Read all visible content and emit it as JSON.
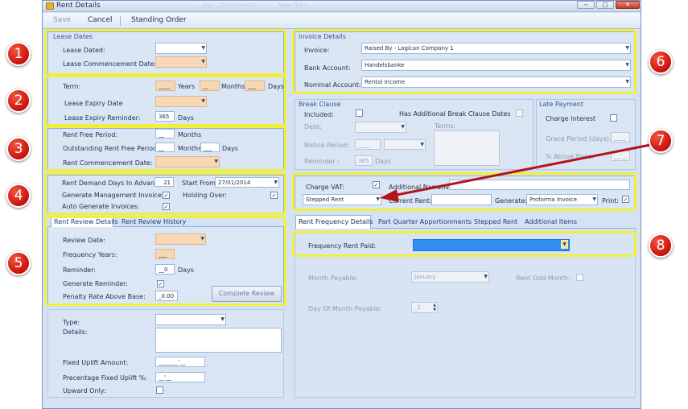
{
  "window": {
    "title": "Rent Details",
    "ghost_text": [
      "...ons \\ Documents",
      "New Item"
    ],
    "controls": [
      "−",
      "□",
      "✕"
    ]
  },
  "toolbar": {
    "save": "Save",
    "cancel": "Cancel",
    "standing_order": "Standing Order"
  },
  "lease_dates": {
    "title": "Lease Dates",
    "lease_dated_label": "Lease Dated:",
    "commencement_label": "Lease Commencement Date:"
  },
  "term": {
    "term_label": "Term:",
    "years_value": "____",
    "years_label": "Years",
    "months_value": "__",
    "months_label": "Months",
    "days_value": "___",
    "days_label": "Days",
    "expiry_label": "Lease Expiry Date",
    "reminder_label": "Lease  Expiry Reminder:",
    "reminder_value": "365",
    "reminder_days": "Days"
  },
  "rent_free": {
    "period_label": "Rent Free Period:",
    "period_value": "__",
    "period_months": "Months",
    "outstanding_label": "Outstanding Rent Free Period:",
    "outstanding_value": "__",
    "outstanding_months": "Months",
    "outstanding_days_value": "___",
    "outstanding_days": "Days",
    "commencement_label": "Rent Commencement Date:"
  },
  "demand": {
    "advance_label": "Rent Demand Days In Advance:",
    "advance_value": "21",
    "start_label": "Start From:",
    "start_value": "27/01/2014",
    "mgmt_invoice_label": "Generate Management Invoice:",
    "mgmt_invoice_checked": "✓",
    "holding_over_label": "Holding Over:",
    "holding_over_checked": "✓",
    "auto_invoices_label": "Auto Generate Invoices:",
    "auto_invoices_checked": "✓"
  },
  "rent_review": {
    "tabs": [
      "Rent Review Details",
      "Rent Review History"
    ],
    "review_date_label": "Review Date:",
    "frequency_label": "Frequency Years:",
    "frequency_value": "___",
    "reminder_label": "Reminder:",
    "reminder_value": "__0",
    "reminder_days": "Days",
    "gen_reminder_label": "Generate Reminder:",
    "gen_reminder_checked": "✓",
    "penalty_label": "Penalty Rate Above Base:",
    "penalty_value": "_0.00",
    "complete_button": "Complete Review"
  },
  "uplift": {
    "type_label": "Type:",
    "details_label": "Details:",
    "fixed_label": "Fixed Uplift Amount:",
    "fixed_value": "_______'__",
    "pct_label": "Precentage Fixed Uplift %:",
    "pct_value": "__'__",
    "upward_label": "Upward Only:"
  },
  "invoice_details": {
    "title": "Invoice Details",
    "invoice_label": "Invoice:",
    "invoice_value": "Raised By - Logican Company 1",
    "bank_label": "Bank Account:",
    "bank_value": "Handelsbanke",
    "nominal_label": "Nominal Account:",
    "nominal_value": "Rental Income"
  },
  "break_clause": {
    "title": "Break Clause",
    "included_label": "Included:",
    "additional_label": "Has Additional Break Clause Dates",
    "date_label": "Date:",
    "terms_label": "Terms:",
    "notice_label": "Notice Period:",
    "notice_value": "____",
    "reminder_label": "Reminder :",
    "reminder_value": "365",
    "reminder_days": "Days"
  },
  "late_payment": {
    "title": "Late Payment",
    "interest_label": "Charge Interest",
    "grace_label": "Grace Period (days):",
    "grace_value": "____",
    "above_label": "% Above Base:",
    "above_value": "__'__"
  },
  "charges": {
    "vat_label": "Charge VAT:",
    "vat_checked": "✓",
    "narrative_label": "Additional Narrative:",
    "stepped_value": "Stepped Rent",
    "current_rent_label": "Current Rent:",
    "generate_label": "Generate:",
    "generate_value": "Proforma Invoice",
    "print_label": "Print:",
    "print_checked": "✓"
  },
  "frequency_tabs": {
    "tabs": [
      "Rent Frequency Details",
      "Part Quarter Apportionments",
      "Stepped Rent",
      "Additional Items"
    ],
    "paid_label": "Frequency Rent Paid:",
    "month_label": "Month Payable:",
    "month_value": "January",
    "odd_label": "Rent Odd Month:",
    "day_label": "Day Of Month Payable:",
    "day_value": "_1"
  },
  "annotations": [
    "1",
    "2",
    "3",
    "4",
    "5",
    "6",
    "7",
    "8"
  ],
  "colors": {
    "highlight": "#f2ef3a",
    "badge": "#d0140f",
    "arrow": "#b3141a",
    "accent_field": "#2e8ff0",
    "tan_field": "#f8d8b4"
  }
}
